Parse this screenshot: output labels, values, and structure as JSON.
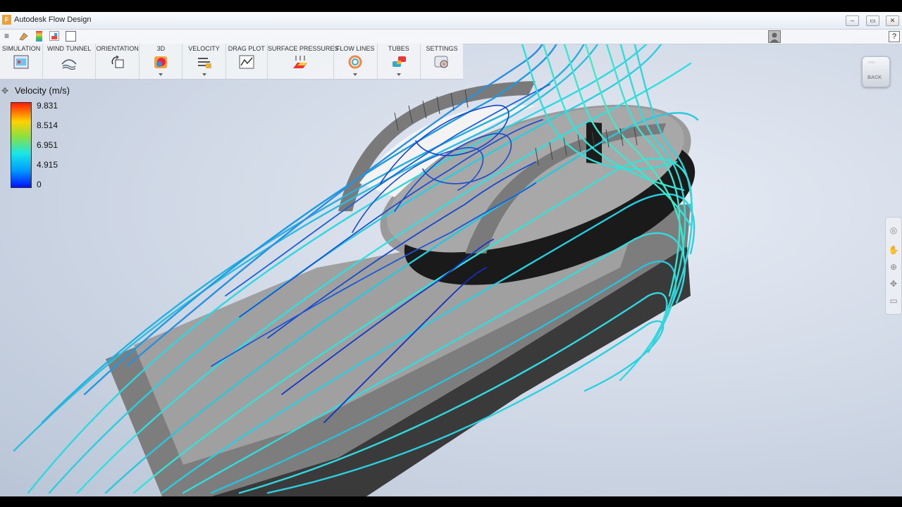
{
  "window": {
    "title": "Autodesk Flow Design",
    "app_logo": "F"
  },
  "window_controls": {
    "minimize": "–",
    "restore": "▭",
    "close": "✕"
  },
  "quick_access": {
    "menu_icon": "≡",
    "help": "?"
  },
  "ribbon": {
    "tabs": [
      {
        "label": "SIMULATION",
        "icon": "simulation-icon",
        "caret": false
      },
      {
        "label": "WIND TUNNEL",
        "icon": "wind-tunnel-icon",
        "caret": false
      },
      {
        "label": "ORIENTATION",
        "icon": "orientation-icon",
        "caret": false
      },
      {
        "label": "3D",
        "icon": "3d-icon",
        "caret": true
      },
      {
        "label": "VELOCITY",
        "icon": "velocity-icon",
        "caret": true
      },
      {
        "label": "DRAG PLOT",
        "icon": "drag-plot-icon",
        "caret": false
      },
      {
        "label": "SURFACE PRESSURES",
        "icon": "surface-pressures-icon",
        "caret": false
      },
      {
        "label": "FLOW LINES",
        "icon": "flow-lines-icon",
        "caret": true
      },
      {
        "label": "TUBES",
        "icon": "tubes-icon",
        "caret": true
      },
      {
        "label": "SETTINGS",
        "icon": "settings-icon",
        "caret": false
      }
    ]
  },
  "legend": {
    "title": "Velocity (m/s)",
    "values": [
      "9.831",
      "8.514",
      "6.951",
      "4.915",
      "0"
    ],
    "gradient": [
      "#ff1a0a",
      "#ffd200",
      "#8ce040",
      "#19e6e6",
      "#009dff",
      "#0010ff"
    ]
  },
  "viewcube": {
    "label": "BACK"
  },
  "colors": {
    "streamline_slow": "#1030c8",
    "streamline_fast": "#30e0e0",
    "model": "#8a8a8a",
    "background": "#d3dbe8"
  }
}
